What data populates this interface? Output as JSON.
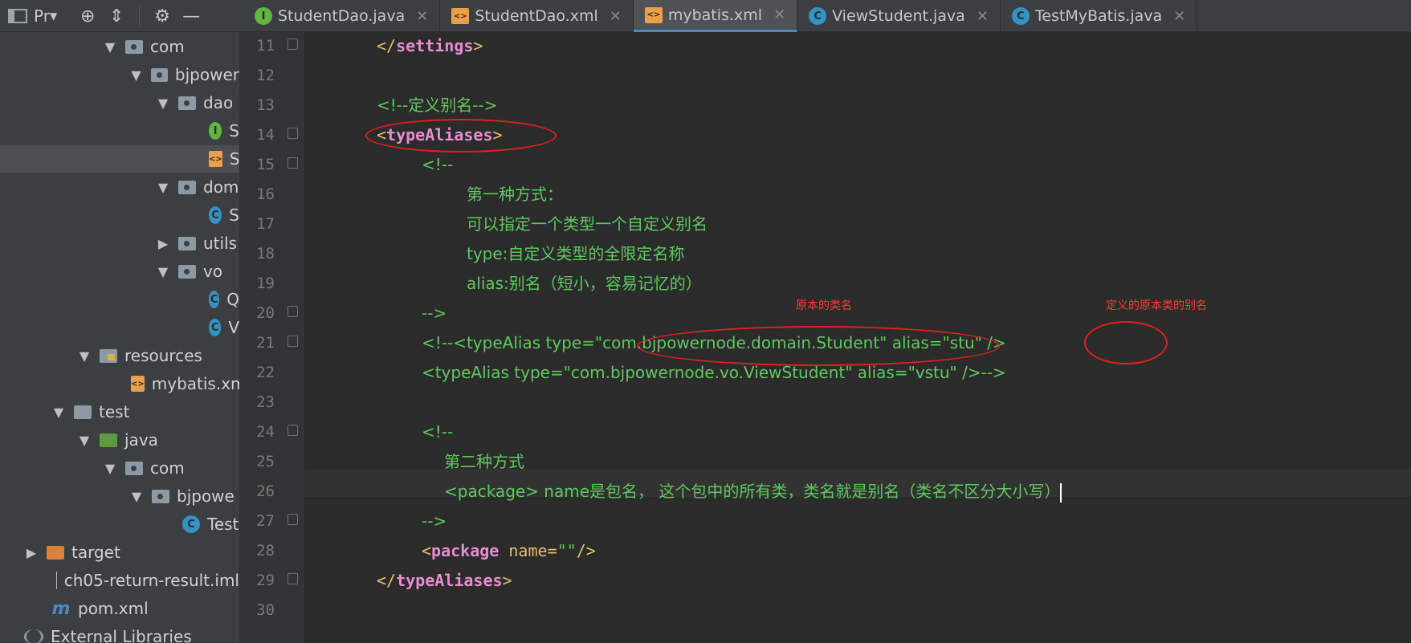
{
  "toolbar": {
    "project_label": "Pr",
    "icons": [
      "project-icon",
      "crosshair-icon",
      "collapse-icon",
      "gear-icon",
      "minimize-icon"
    ]
  },
  "tabs": [
    {
      "label": "StudentDao.java",
      "icon": "interface-icon",
      "active": false
    },
    {
      "label": "StudentDao.xml",
      "icon": "xml-icon",
      "active": false
    },
    {
      "label": "mybatis.xml",
      "icon": "xml-icon",
      "active": true
    },
    {
      "label": "ViewStudent.java",
      "icon": "class-icon",
      "active": false
    },
    {
      "label": "TestMyBatis.java",
      "icon": "class-icon",
      "active": false
    }
  ],
  "tree": [
    {
      "label": "com",
      "kind": "package"
    },
    {
      "label": "bjpower",
      "kind": "package"
    },
    {
      "label": "dao",
      "kind": "package"
    },
    {
      "label": "S",
      "kind": "interface"
    },
    {
      "label": "S",
      "kind": "xml"
    },
    {
      "label": "dom",
      "kind": "package"
    },
    {
      "label": "S",
      "kind": "class"
    },
    {
      "label": "utils",
      "kind": "package"
    },
    {
      "label": "vo",
      "kind": "package"
    },
    {
      "label": "Q",
      "kind": "class"
    },
    {
      "label": "V",
      "kind": "class"
    },
    {
      "label": "resources",
      "kind": "resources"
    },
    {
      "label": "mybatis.xml",
      "kind": "xml"
    },
    {
      "label": "test",
      "kind": "folder"
    },
    {
      "label": "java",
      "kind": "source"
    },
    {
      "label": "com",
      "kind": "package"
    },
    {
      "label": "bjpowe",
      "kind": "package"
    },
    {
      "label": "Test",
      "kind": "class"
    },
    {
      "label": "target",
      "kind": "excluded"
    },
    {
      "label": "ch05-return-result.iml",
      "kind": "iml"
    },
    {
      "label": "pom.xml",
      "kind": "maven"
    },
    {
      "label": "External Libraries",
      "kind": "libraries"
    }
  ],
  "line_numbers": [
    "11",
    "12",
    "13",
    "14",
    "15",
    "16",
    "17",
    "18",
    "19",
    "20",
    "21",
    "22",
    "23",
    "24",
    "25",
    "26",
    "27",
    "28",
    "29",
    "30"
  ],
  "code": {
    "l11": "settings",
    "l13": "<!--定义别名-->",
    "l14": "typeAliases",
    "l15": "<!--",
    "l16": "第一种方式：",
    "l17": "可以指定一个类型一个自定义别名",
    "l18": "type:自定义类型的全限定名称",
    "l19": "alias:别名（短小，容易记忆的）",
    "l20": "-->",
    "l21": "<!--<typeAlias type=\"com.bjpowernode.domain.Student\" alias=\"stu\" />",
    "l22": "<typeAlias type=\"com.bjpowernode.vo.ViewStudent\" alias=\"vstu\" />-->",
    "l24": "<!--",
    "l25": "第二种方式",
    "l26": "<package> name是包名， 这个包中的所有类，类名就是别名（类名不区分大小写）",
    "l27": "-->",
    "l28_tag": "package",
    "l28_attr": "name",
    "l28_val": "\"\"",
    "l29": "typeAliases"
  },
  "annotations": {
    "original_class": "原本的类名",
    "alias_of_class": "定义的原本类的别名"
  },
  "colors": {
    "annotation_red": "#e0201a",
    "comment_green": "#629755",
    "tag_yellow": "#e8bf6a",
    "keyword_pink": "#e98cd0"
  }
}
